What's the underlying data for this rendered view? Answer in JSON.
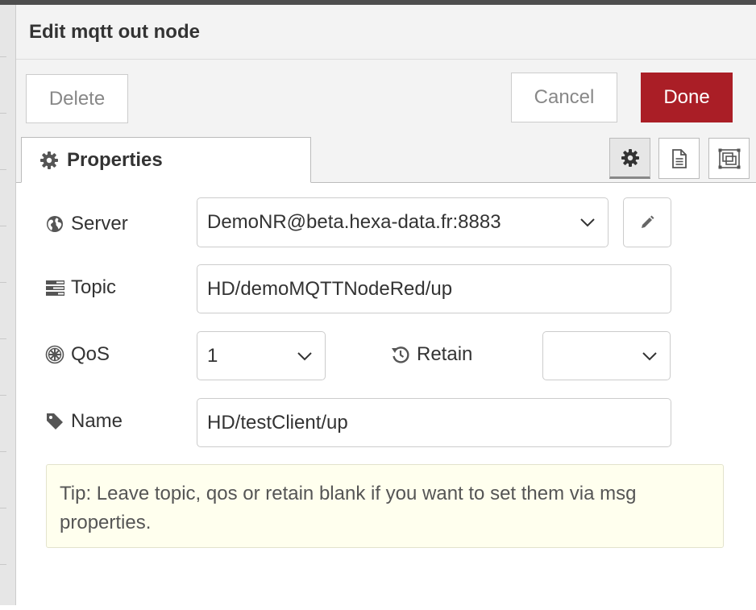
{
  "tray": {
    "title": "Edit mqtt out node",
    "delete_label": "Delete",
    "cancel_label": "Cancel",
    "done_label": "Done"
  },
  "tabs": {
    "properties_label": "Properties",
    "icons": [
      "gear-icon",
      "description-icon",
      "appearance-icon"
    ]
  },
  "form": {
    "server": {
      "label": "Server",
      "value": "DemoNR@beta.hexa-data.fr:8883"
    },
    "topic": {
      "label": "Topic",
      "value": "HD/demoMQTTNodeRed/up"
    },
    "qos": {
      "label": "QoS",
      "value": "1"
    },
    "retain": {
      "label": "Retain",
      "value": ""
    },
    "name": {
      "label": "Name",
      "value": "HD/testClient/up"
    }
  },
  "tip": "Tip: Leave topic, qos or retain blank if you want to set them via msg properties.",
  "colors": {
    "done_button": "#aa1e26",
    "header_bg": "#f3f3f3",
    "tip_bg": "#ffffee"
  }
}
